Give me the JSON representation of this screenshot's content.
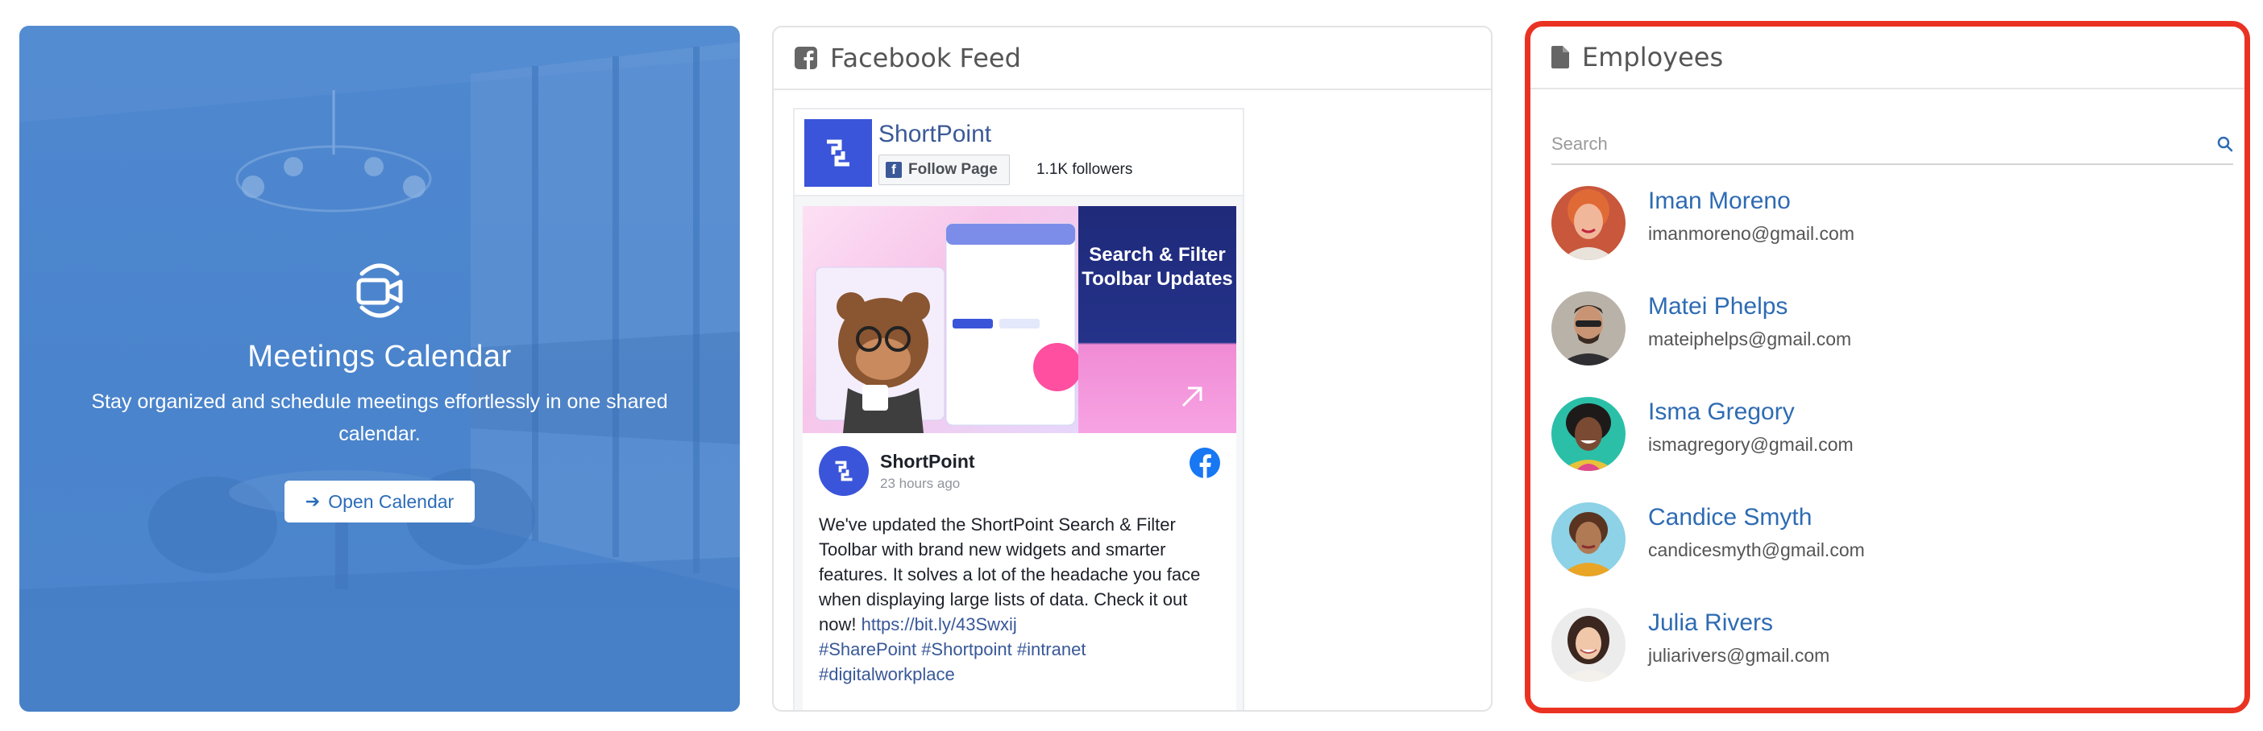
{
  "meetings": {
    "title": "Meetings Calendar",
    "description": "Stay organized and schedule meetings effortlessly in one shared calendar.",
    "button_label": "Open Calendar",
    "icon": "video-camera-icon"
  },
  "facebook": {
    "header": "Facebook Feed",
    "page_name": "ShortPoint",
    "follow_label": "Follow Page",
    "followers": "1.1K followers",
    "promo": "Search & Filter Toolbar Updates",
    "post": {
      "author": "ShortPoint",
      "time": "23 hours ago",
      "body": "We've updated the ShortPoint Search & Filter Toolbar with brand new widgets and smarter features. It solves a lot of the headache you face when displaying large lists of data. Check it out now! ",
      "link": "https://bit.ly/43Swxij",
      "tags": "#SharePoint #Shortpoint #intranet #digitalworkplace"
    }
  },
  "employees": {
    "header": "Employees",
    "search_placeholder": "Search",
    "list": [
      {
        "name": "Iman Moreno",
        "email": "imanmoreno@gmail.com"
      },
      {
        "name": "Matei Phelps",
        "email": "mateiphelps@gmail.com"
      },
      {
        "name": "Isma Gregory",
        "email": "ismagregory@gmail.com"
      },
      {
        "name": "Candice Smyth",
        "email": "candicesmyth@gmail.com"
      },
      {
        "name": "Julia Rivers",
        "email": "juliarivers@gmail.com"
      }
    ]
  },
  "colors": {
    "meetings_bg": "#4a84cc",
    "link_blue": "#2e6bb3",
    "highlight_border": "#ea3223",
    "facebook_blue": "#3b5998"
  }
}
